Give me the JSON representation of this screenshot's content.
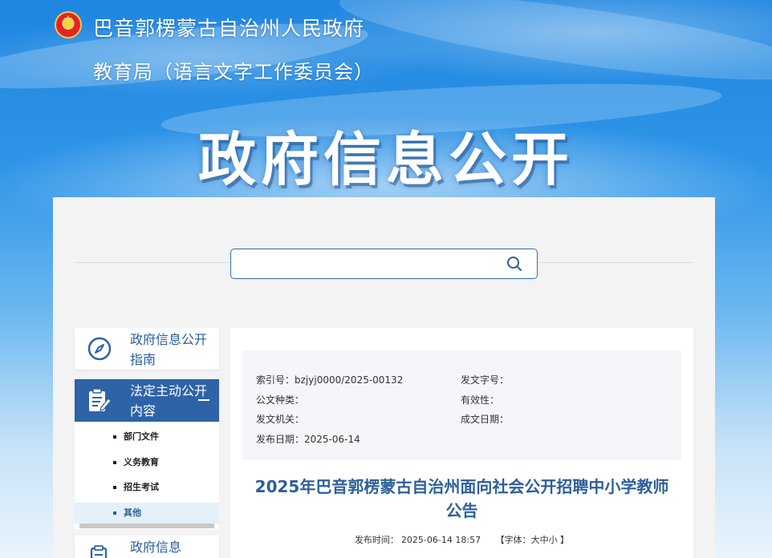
{
  "header": {
    "site_title": "巴音郭楞蒙古自治州人民政府",
    "site_subtitle": "教育局（语言文字工作委员会）",
    "hero_title": "政府信息公开"
  },
  "search": {
    "value": "",
    "placeholder": ""
  },
  "sidebar": {
    "items": [
      {
        "label": "政府信息公开指南",
        "icon": "compass-icon"
      },
      {
        "label": "法定主动公开内容",
        "icon": "document-edit-icon",
        "expanded": true
      },
      {
        "label": "政府信息",
        "icon": "document-icon"
      }
    ],
    "sub_items": [
      {
        "label": "部门文件"
      },
      {
        "label": "义务教育"
      },
      {
        "label": "招生考试"
      },
      {
        "label": "其他",
        "active": true
      }
    ]
  },
  "document": {
    "index_label": "索引号：",
    "index_value": "bzjyj0000/2025-00132",
    "doc_number_label": "发文字号：",
    "doc_number_value": "",
    "category_label": "公文种类：",
    "category_value": "",
    "validity_label": "有效性：",
    "validity_value": "",
    "issuer_label": "发文机关：",
    "issuer_value": "",
    "created_label": "成文日期：",
    "created_value": "",
    "publish_date_label": "发布日期：",
    "publish_date_value": "2025-06-14",
    "title": "2025年巴音郭楞蒙古自治州面向社会公开招聘中小学教师公告",
    "pub_time_label": "发布时间：",
    "pub_time_value": "2025-06-14 18:57",
    "font_label": "【字体：",
    "font_large": "大",
    "font_medium": "中",
    "font_small": "小",
    "font_close": " 】"
  },
  "colors": {
    "primary": "#2e63a8",
    "title_blue": "#2d5f9a",
    "active_sub_bg": "#e4f1fb"
  }
}
